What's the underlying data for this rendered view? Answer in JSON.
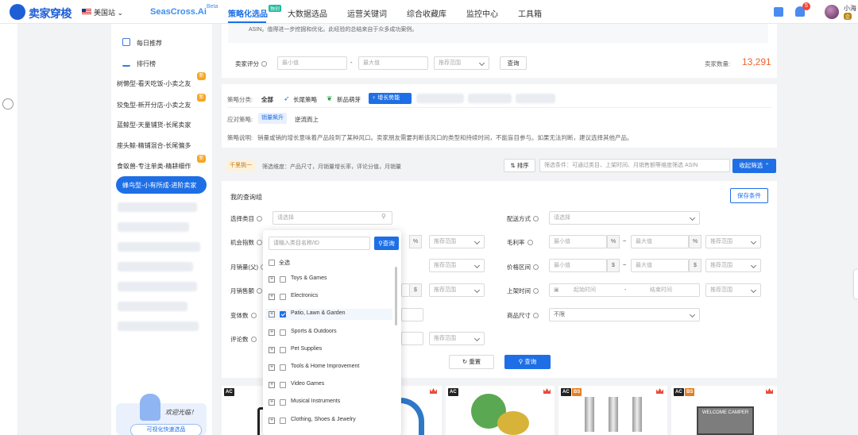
{
  "topbar": {
    "logo": "卖家穿梭",
    "site": "美国站",
    "seascross": "SeasCross.Ai",
    "beta": "Beta",
    "nav": [
      "策略化选品",
      "大数据选品",
      "运营关键词",
      "综合收藏库",
      "监控中心",
      "工具箱"
    ],
    "hot_tag": "独创",
    "notif_count": "5",
    "user_name": "小海",
    "user_tag": "企"
  },
  "sidebar": {
    "daily": "每日推荐",
    "ranking": "排行榜",
    "strategies": [
      "树懒型-看天吃饭-小卖之友",
      "狡兔型-新开分店-小卖之友",
      "蓝鲸型-天量铺货-长尾卖家",
      "座头鲸-精铺混合-长尾偏多",
      "食蚁兽-专注单类-精耕细作",
      "蜂鸟型-小有所成-进阶卖家"
    ],
    "new_tag": "新",
    "welcome": "欢迎光临！",
    "quick_select": "可视化快速选品"
  },
  "top_card": {
    "desc": "ASIN。值得进一步挖掘和优化。此经验的总结来自于众多成功案例。",
    "seller_rating_label": "卖家评分",
    "min_ph": "最小值",
    "max_ph": "最大值",
    "range_ph": "推荐范围",
    "query": "查询",
    "seller_count_label": "卖家数量:",
    "seller_count": "13,291"
  },
  "strategy_card": {
    "category_label": "策略分类:",
    "categories": [
      "全部",
      "长尾策略",
      "新品萌芽",
      "增长势能"
    ],
    "response_label": "应对策略:",
    "responses": [
      "销量飙升",
      "逆流而上"
    ],
    "explain_label": "策略说明:",
    "explain": "销量或销的增长意味着产品段到了某种风口。卖家朋友需要判断该风口的类型和持续时间，不能盲目参与。如果无法判断，建议选择其他产品。"
  },
  "filter_bar": {
    "tag": "千里挑一",
    "dims": "筛选维度：产品尺寸，月销量增长率，评论分值，月销量",
    "sort": "排序",
    "cond_placeholder": "筛选条件：可通过类目、上架时间、月销售额等维度筛选 ASIN",
    "collapse": "收起筛选"
  },
  "query_group": {
    "title": "我的查询组",
    "save": "保存条件",
    "labels_left": [
      "选择类目",
      "机会指数",
      "月销量(父)",
      "月销售额",
      "变体数",
      "评论数"
    ],
    "labels_right": [
      "配送方式",
      "毛利率",
      "价格区间",
      "上架时间",
      "商品尺寸"
    ],
    "select_ph": "请选择",
    "min_ph": "最小值",
    "max_ph": "最大值",
    "range_ph": "推荐范围",
    "start_ph": "起始时间",
    "end_ph": "结束时间",
    "unlimited": "不限",
    "pct": "%",
    "dollar": "$",
    "tilde": "~",
    "dash": "-",
    "reset": "重置",
    "query": "查询"
  },
  "dropdown": {
    "search_ph": "请输入类目名称/ID",
    "search_btn": "查询",
    "select_all": "全选",
    "items": [
      {
        "name": "Toys & Games",
        "checked": false
      },
      {
        "name": "Electronics",
        "checked": false
      },
      {
        "name": "Patio, Lawn & Garden",
        "checked": true
      },
      {
        "name": "Sports & Outdoors",
        "checked": false
      },
      {
        "name": "Pet Supplies",
        "checked": false
      },
      {
        "name": "Tools & Home Improvement",
        "checked": false
      },
      {
        "name": "Video Games",
        "checked": false
      },
      {
        "name": "Musical Instruments",
        "checked": false
      },
      {
        "name": "Clothing, Shoes & Jewelry",
        "checked": false
      }
    ]
  },
  "products": {
    "ac": "AC",
    "bs": "BS",
    "sign_text": "WELCOME CAMPER"
  }
}
